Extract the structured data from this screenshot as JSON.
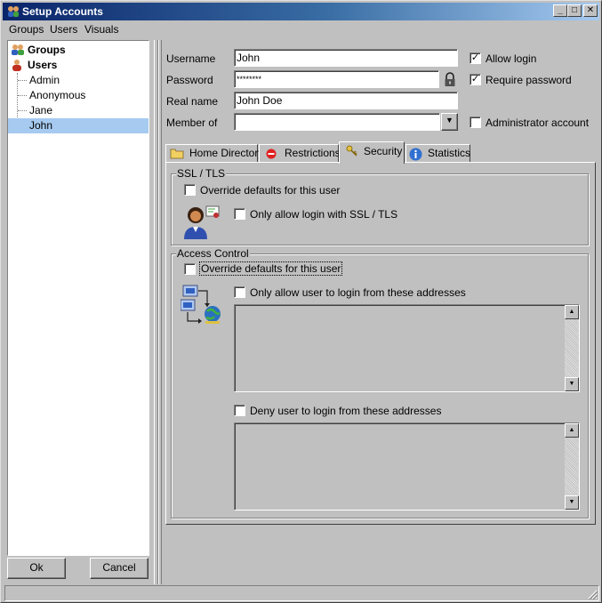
{
  "window": {
    "title": "Setup Accounts"
  },
  "menu": [
    "Groups",
    "Users",
    "Visuals"
  ],
  "tree": {
    "groups_label": "Groups",
    "users_label": "Users",
    "users": [
      "Admin",
      "Anonymous",
      "Jane",
      "John"
    ],
    "selected": "John"
  },
  "buttons": {
    "ok": "Ok",
    "cancel": "Cancel"
  },
  "form": {
    "username_label": "Username",
    "username_value": "John",
    "password_label": "Password",
    "password_value": "********",
    "realname_label": "Real name",
    "realname_value": "John Doe",
    "memberof_label": "Member of",
    "memberof_value": "",
    "allow_login": {
      "label": "Allow login",
      "checked": true
    },
    "require_password": {
      "label": "Require password",
      "checked": true
    },
    "admin_account": {
      "label": "Administrator account",
      "checked": false
    }
  },
  "tabs": [
    {
      "label": "Home Directory",
      "icon": "folder-icon"
    },
    {
      "label": "Restrictions",
      "icon": "no-entry-icon"
    },
    {
      "label": "Security",
      "icon": "key-icon"
    },
    {
      "label": "Statistics",
      "icon": "info-icon"
    }
  ],
  "active_tab": "Security",
  "ssl": {
    "title": "SSL / TLS",
    "override_label": "Override defaults for this user",
    "only_ssl_label": "Only allow login with SSL / TLS"
  },
  "access": {
    "title": "Access Control",
    "override_label": "Override defaults for this user",
    "allow_label": "Only allow user to login from these addresses",
    "deny_label": "Deny user to login from these addresses"
  },
  "colors": {
    "title_start": "#0a246a",
    "title_end": "#a6caf0",
    "selection": "#a6caf0",
    "face": "#c0c0c0"
  }
}
